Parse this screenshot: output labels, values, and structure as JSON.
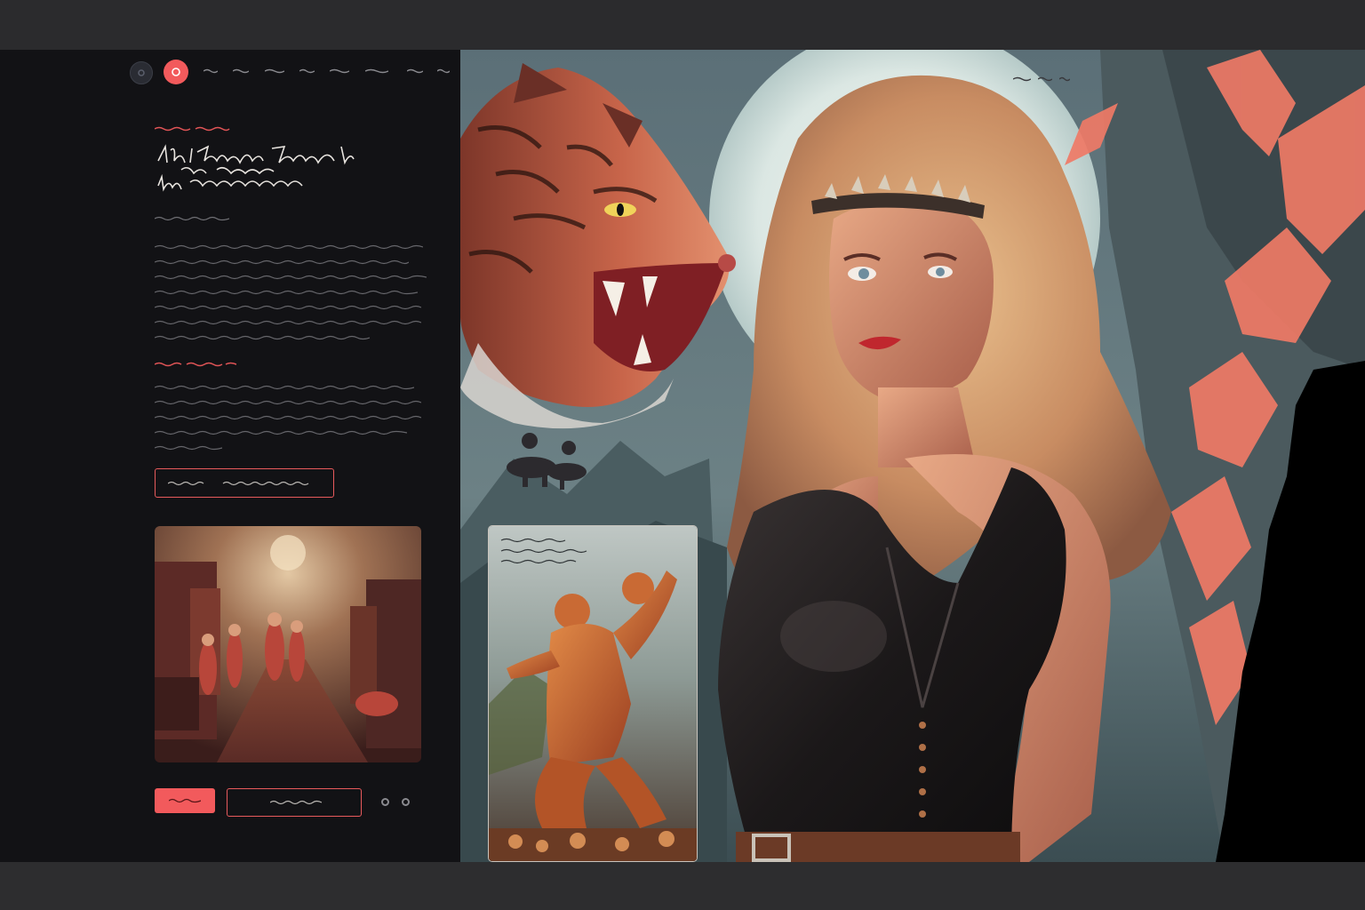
{
  "colors": {
    "accent": "#f25a5c",
    "panel": "#121215",
    "frame": "#2b2b2d",
    "scribble": "#8a8a8f"
  },
  "icons": {
    "nav_left": "circle-icon",
    "nav_active": "circle-dot-icon",
    "pager_prev": "circle-icon",
    "pager_next": "circle-icon"
  },
  "nav": {
    "item_count": 7
  },
  "hero": {
    "nav_item_count": 3
  }
}
